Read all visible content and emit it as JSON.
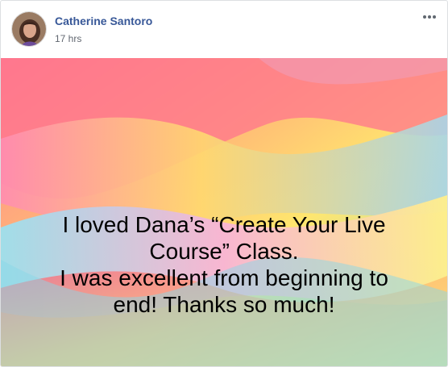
{
  "post": {
    "author_name": "Catherine Santoro",
    "timestamp": "17 hrs",
    "lines": [
      "I loved Dana’s “Create Your Live",
      "Course” Class.",
      "I was excellent from beginning to",
      "end! Thanks so much!"
    ]
  },
  "icons": {
    "avatar": "profile-photo",
    "more": "more-options-icon"
  },
  "colors": {
    "author_link": "#385898",
    "timestamp": "#616770",
    "border": "#dddfe2",
    "background_palette": [
      "#ff6f91",
      "#ffd36b",
      "#ffb86b",
      "#8fd8e8",
      "#f58ab8",
      "#ffe66e"
    ]
  }
}
